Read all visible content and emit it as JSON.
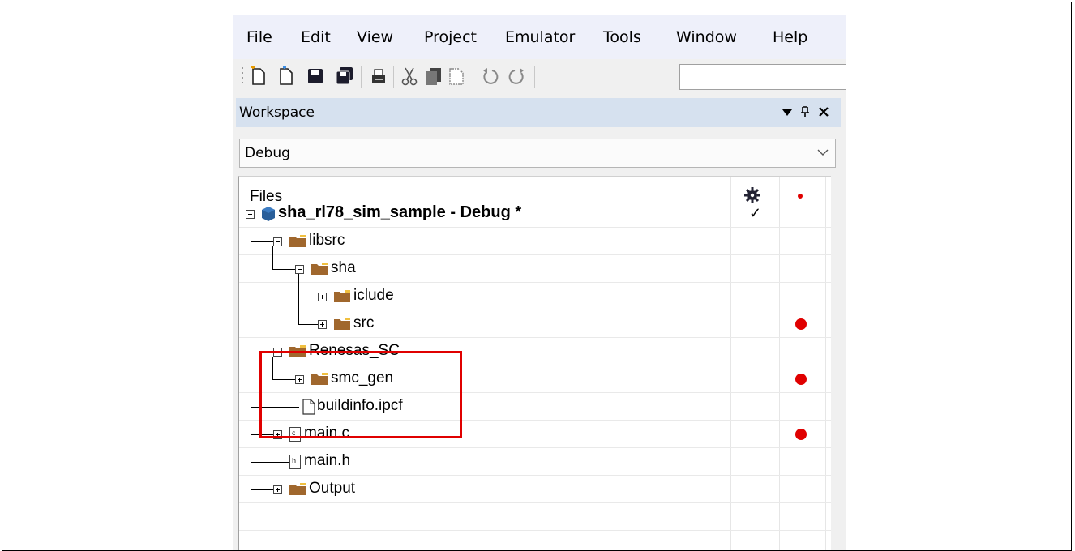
{
  "menu": {
    "items": [
      "File",
      "Edit",
      "View",
      "Project",
      "Emulator",
      "Tools",
      "Window",
      "Help"
    ]
  },
  "toolbar": {
    "icons": [
      "new-file-icon",
      "new-project-icon",
      "save-icon",
      "save-all-icon",
      "print-icon",
      "cut-icon",
      "copy-icon",
      "paste-icon",
      "undo-icon",
      "redo-icon"
    ]
  },
  "workspace": {
    "title": "Workspace",
    "configuration": "Debug",
    "tree_header": "Files",
    "project": {
      "label": "sha_rl78_sim_sample - Debug *",
      "build_check": "✓"
    },
    "items": [
      {
        "label": "libsrc",
        "type": "folder",
        "expander": "minus",
        "red_dot": false
      },
      {
        "label": "sha",
        "type": "folder",
        "expander": "minus",
        "red_dot": false
      },
      {
        "label": "iclude",
        "type": "folder",
        "expander": "plus",
        "red_dot": false
      },
      {
        "label": "src",
        "type": "folder",
        "expander": "plus",
        "red_dot": true
      },
      {
        "label": "Renesas_SC",
        "type": "folder",
        "expander": "minus",
        "red_dot": false
      },
      {
        "label": "smc_gen",
        "type": "folder",
        "expander": "plus",
        "red_dot": true
      },
      {
        "label": "buildinfo.ipcf",
        "type": "file",
        "expander": "none",
        "red_dot": false
      },
      {
        "label": "main.c",
        "type": "c-file",
        "expander": "plus",
        "red_dot": true
      },
      {
        "label": "main.h",
        "type": "h-file",
        "expander": "none",
        "red_dot": false
      },
      {
        "label": "Output",
        "type": "folder",
        "expander": "plus",
        "red_dot": false
      }
    ],
    "file_icon_letters": {
      "c": "c",
      "h": "h"
    }
  },
  "colors": {
    "highlight": "#e00000",
    "breakpoint_dot": "#e00000",
    "folder": "#a0672d",
    "title_bar": "#d6e1ef",
    "menubar": "#eef0fa"
  }
}
